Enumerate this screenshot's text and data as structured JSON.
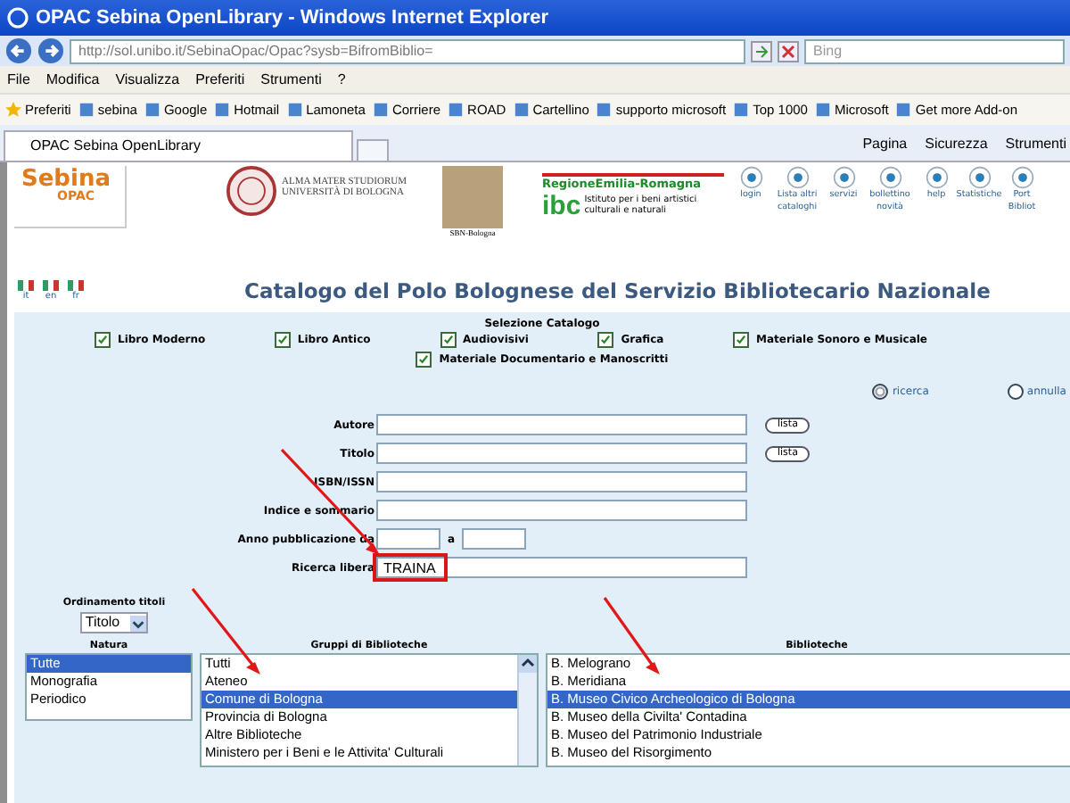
{
  "browser": {
    "title": "OPAC Sebina OpenLibrary - Windows Internet Explorer",
    "address": "http://sol.unibo.it/SebinaOpac/Opac?sysb=BifromBiblio=",
    "search_placeholder": "Bing",
    "menu": [
      "File",
      "Modifica",
      "Visualizza",
      "Preferiti",
      "Strumenti",
      "?"
    ],
    "favorites_label": "Preferiti",
    "favorites": [
      {
        "label": "sebina"
      },
      {
        "label": "Google"
      },
      {
        "label": "Hotmail"
      },
      {
        "label": "Lamoneta"
      },
      {
        "label": "Corriere"
      },
      {
        "label": "ROAD"
      },
      {
        "label": "Cartellino"
      },
      {
        "label": "supporto microsoft"
      },
      {
        "label": "Top 1000"
      },
      {
        "label": "Microsoft"
      },
      {
        "label": "Get more Add-on"
      }
    ],
    "tab": {
      "label": "OPAC Sebina OpenLibrary"
    },
    "commands": [
      "Pagina",
      "Sicurezza",
      "Strumenti"
    ]
  },
  "header": {
    "logo_name": "Sebina",
    "logo_sub": "OPAC",
    "university": [
      "ALMA MATER STUDIORUM",
      "UNIVERSITÀ DI BOLOGNA"
    ],
    "sbn_label": "SBN-Bologna",
    "region": "RegioneEmilia-Romagna",
    "ibc": "ibc",
    "ibc_text": "Istituto per i beni artistici culturali e naturali",
    "nav": [
      {
        "label": "login"
      },
      {
        "label": "Lista altri cataloghi"
      },
      {
        "label": "servizi"
      },
      {
        "label": "bollettino novità"
      },
      {
        "label": "help"
      },
      {
        "label": "Statistiche"
      },
      {
        "label": "Port Bibliot"
      }
    ],
    "languages": [
      "it",
      "en",
      "fr"
    ],
    "heading": "Catalogo del Polo Bolognese del Servizio Bibliotecario Nazionale"
  },
  "form": {
    "catalog_title": "Selezione Catalogo",
    "catalogs": [
      {
        "label": "Libro Moderno",
        "checked": true
      },
      {
        "label": "Libro Antico",
        "checked": true
      },
      {
        "label": "Audiovisivi",
        "checked": true
      },
      {
        "label": "Grafica",
        "checked": true
      },
      {
        "label": "Materiale Sonoro e Musicale",
        "checked": true
      },
      {
        "label": "Materiale Documentario e Manoscritti",
        "checked": true
      }
    ],
    "actions": [
      {
        "label": "ricerca",
        "selected": true
      },
      {
        "label": "annulla",
        "selected": false
      }
    ],
    "fields": [
      {
        "label": "Autore",
        "kind": "lista",
        "button": "lista"
      },
      {
        "label": "Titolo",
        "kind": "lista",
        "button": "lista"
      },
      {
        "label": "ISBN/ISSN",
        "kind": "text"
      },
      {
        "label": "Indice e sommario",
        "kind": "text"
      },
      {
        "label": "Anno pubblicazione da",
        "kind": "range",
        "to_label": "a"
      },
      {
        "label": "Ricerca libera",
        "kind": "text",
        "value": "TRAINA",
        "highlighted": true
      }
    ],
    "sort": {
      "label": "Ordinamento titoli",
      "value": "Titolo"
    },
    "lists": [
      {
        "title": "Natura",
        "items": [
          {
            "label": "Tutte",
            "selected": true
          },
          {
            "label": "Monografia",
            "selected": false
          },
          {
            "label": "Periodico",
            "selected": false
          }
        ]
      },
      {
        "title": "Gruppi di Biblioteche",
        "scrollbar": true,
        "items": [
          {
            "label": "Tutti",
            "selected": false
          },
          {
            "label": "Ateneo",
            "selected": false
          },
          {
            "label": "Comune di Bologna",
            "selected": true
          },
          {
            "label": "Provincia di Bologna",
            "selected": false
          },
          {
            "label": "Altre Biblioteche",
            "selected": false
          },
          {
            "label": "Ministero per i Beni e le Attivita' Culturali",
            "selected": false
          }
        ]
      },
      {
        "title": "Biblioteche",
        "items": [
          {
            "label": "B. Melograno",
            "selected": false
          },
          {
            "label": "B. Meridiana",
            "selected": false
          },
          {
            "label": "B. Museo Civico Archeologico di Bologna",
            "selected": true
          },
          {
            "label": "B. Museo della Civilta' Contadina",
            "selected": false
          },
          {
            "label": "B. Museo del Patrimonio Industriale",
            "selected": false
          },
          {
            "label": "B. Museo del Risorgimento",
            "selected": false
          }
        ]
      }
    ]
  }
}
